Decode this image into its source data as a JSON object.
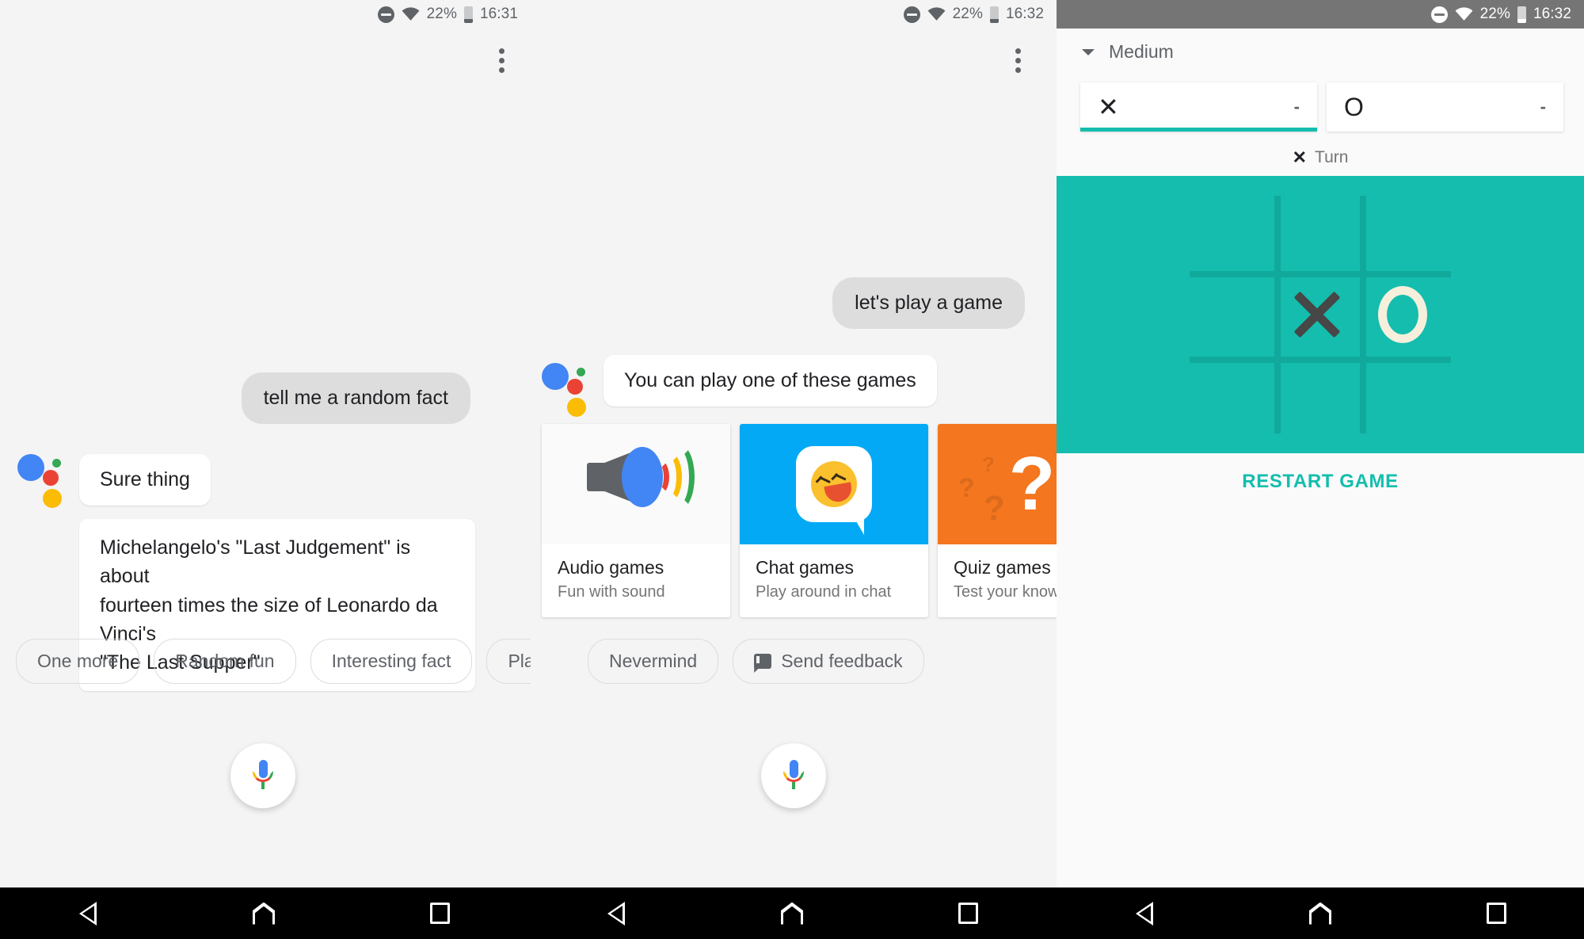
{
  "status_bars": [
    {
      "dnd": "do-not-disturb",
      "wifi": "wifi",
      "battery_pct": "22%",
      "time": "16:31"
    },
    {
      "dnd": "do-not-disturb",
      "wifi": "wifi",
      "battery_pct": "22%",
      "time": "16:32"
    },
    {
      "dnd": "do-not-disturb",
      "wifi": "wifi",
      "battery_pct": "22%",
      "time": "16:32"
    }
  ],
  "left_panel": {
    "overflow_menu": "more-options",
    "messages": [
      {
        "role": "user",
        "text": "tell me a random fact"
      },
      {
        "role": "assistant",
        "text": "Sure thing"
      },
      {
        "role": "assistant",
        "text": "Michelangelo's \"Last Judgement\" is about\nfourteen times the size of Leonardo da Vinci's\n\"The Last Supper\""
      }
    ],
    "chips": [
      {
        "label": "One more"
      },
      {
        "label": "Random fun"
      },
      {
        "label": "Interesting fact"
      },
      {
        "label": "Play a game"
      }
    ],
    "mic_button": "microphone"
  },
  "mid_panel": {
    "overflow_menu": "more-options",
    "messages": [
      {
        "role": "user",
        "text": "let's play a game"
      },
      {
        "role": "assistant",
        "text": "You can play one of these games"
      }
    ],
    "cards": [
      {
        "title": "Audio games",
        "subtitle": "Fun with sound",
        "art": "speaker-icon"
      },
      {
        "title": "Chat games",
        "subtitle": "Play around in chat",
        "art": "laughing-emoji-icon"
      },
      {
        "title": "Quiz games",
        "subtitle": "Test your knowledge",
        "art": "question-mark-icon"
      }
    ],
    "chips": [
      {
        "label": "Nevermind",
        "icon": null
      },
      {
        "label": "Send feedback",
        "icon": "feedback-icon"
      }
    ],
    "mic_button": "microphone"
  },
  "right_panel": {
    "difficulty": "Medium",
    "players": [
      {
        "mark": "✕",
        "score": "-",
        "active": true
      },
      {
        "mark": "O",
        "score": "-",
        "active": false
      }
    ],
    "turn_mark": "✕",
    "turn_label": "Turn",
    "board": {
      "cells": [
        "",
        "",
        "",
        "",
        "X",
        "O",
        "",
        "",
        ""
      ],
      "bg_color": "#14bdad",
      "line_color": "#11a99b",
      "x_color": "#474747",
      "o_color": "#f5efdc"
    },
    "restart_label": "RESTART GAME",
    "accent_color": "#14bdad"
  },
  "navbar": {
    "buttons": [
      "back-icon",
      "home-icon",
      "recents-icon"
    ]
  }
}
